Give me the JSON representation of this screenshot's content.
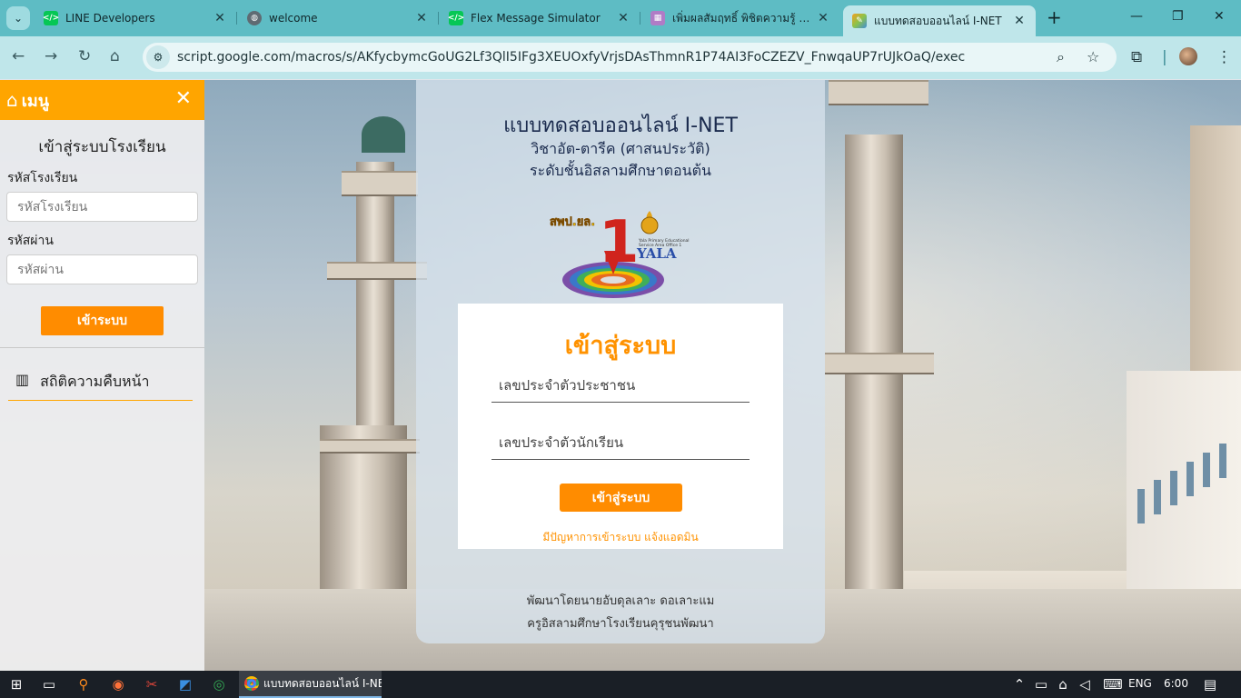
{
  "browser": {
    "tabs": [
      {
        "title": "LINE Developers",
        "favicon": "code-icon",
        "color": "#06c755"
      },
      {
        "title": "welcome",
        "favicon": "globe-icon",
        "color": "#5f6b73"
      },
      {
        "title": "Flex Message Simulator",
        "favicon": "code-icon",
        "color": "#06c755"
      },
      {
        "title": "เพิ่มผลสัมฤทธิ์ พิชิตความรู้ สู่ความ",
        "favicon": "image-icon",
        "color": "#b07cc6"
      },
      {
        "title": "แบบทดสอบออนไลน์ I-NET",
        "favicon": "brush-icon",
        "color": "#f4a020"
      }
    ],
    "url": "script.google.com/macros/s/AKfycbymcGoUG2Lf3QlI5IFg3XEUOxfyVrjsDAsThmnR1P74AI3FoCZEZV_FnwqaUP7rUJkOaQ/exec"
  },
  "sidebar": {
    "header_title": "เมนู",
    "login_title": "เข้าสู่ระบบโรงเรียน",
    "school_code_label": "รหัสโรงเรียน",
    "school_code_placeholder": "รหัสโรงเรียน",
    "password_label": "รหัสผ่าน",
    "password_placeholder": "รหัสผ่าน",
    "login_button": "เข้าระบบ",
    "stats_link": "สถิติความคืบหน้า"
  },
  "panel": {
    "title": "แบบทดสอบออนไลน์ I-NET",
    "subject": "วิชาอัต-ตารีค (ศาสนประวัติ)",
    "level": "ระดับชั้นอิสลามศึกษาตอนต้น",
    "logo": {
      "org_short": "สพป.ยล.",
      "number": "1",
      "org_en_line1": "Yala Primary Educational",
      "org_en_line2": "Service Area Office 1",
      "org_name": "YALA"
    },
    "login_title": "เข้าสู่ระบบ",
    "id_card_placeholder": "เลขประจำตัวประชาชน",
    "student_id_placeholder": "เลขประจำตัวนักเรียน",
    "login_button": "เข้าสู่ระบบ",
    "help_text": "มีปัญหาการเข้าระบบ แจ้งแอดมิน",
    "credit_line1": "พัฒนาโดยนายอับดุลเลาะ ดอเลาะแม",
    "credit_line2": "ครูอิสลามศึกษาโรงเรียนคุรุชนพัฒนา"
  },
  "taskbar": {
    "active_app": "แบบทดสอบออนไลน์ I-NE...",
    "language": "ENG",
    "time": "6:00"
  },
  "colors": {
    "accent": "#ff8c00",
    "sidebar_header": "#ffa500",
    "title_text": "#1b2b4e"
  }
}
